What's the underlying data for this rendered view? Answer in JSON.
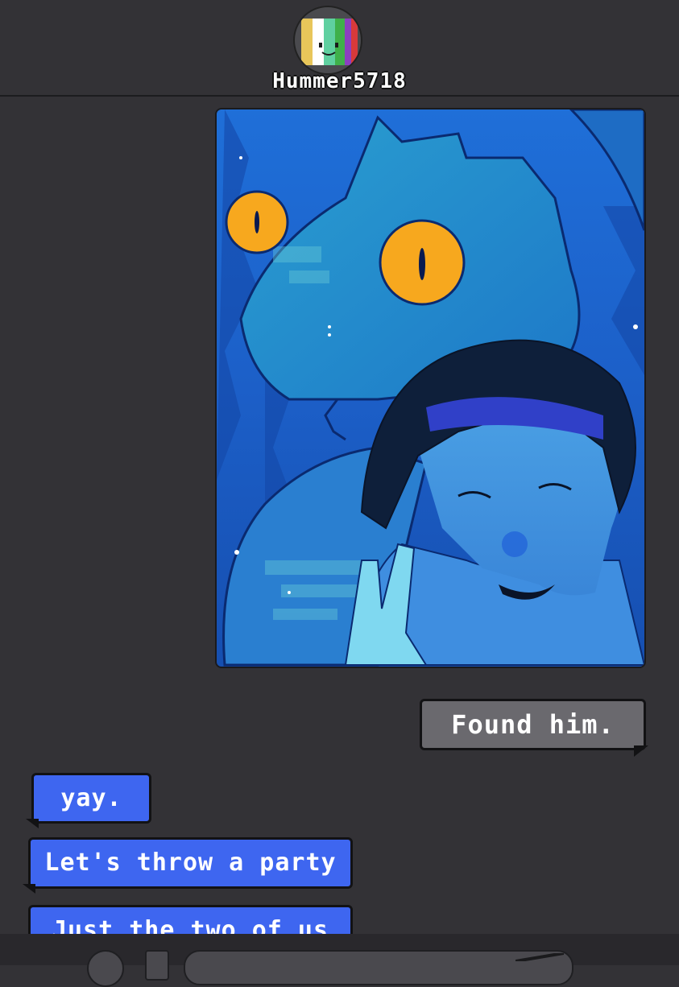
{
  "header": {
    "contact_name": "Hummer5718",
    "avatar_colors": [
      "#e8c65a",
      "#5fd0a0",
      "#3fb04a",
      "#8b3fc0",
      "#d83a3a"
    ]
  },
  "conversation": {
    "attached_image": "illustration-dragon-and-boy",
    "outgoing_messages": [
      {
        "text": "Found him."
      }
    ],
    "incoming_messages": [
      {
        "text": "yay."
      },
      {
        "text": "Let's throw a party"
      },
      {
        "text": "Just the two of us"
      }
    ]
  },
  "composer": {
    "emoji_icon": "emoji-icon",
    "attach_icon": "attach-icon",
    "send_icon": "send-icon"
  },
  "colors": {
    "background": "#333236",
    "outgoing_bubble": "#6a696e",
    "incoming_bubble": "#3e66f0"
  }
}
